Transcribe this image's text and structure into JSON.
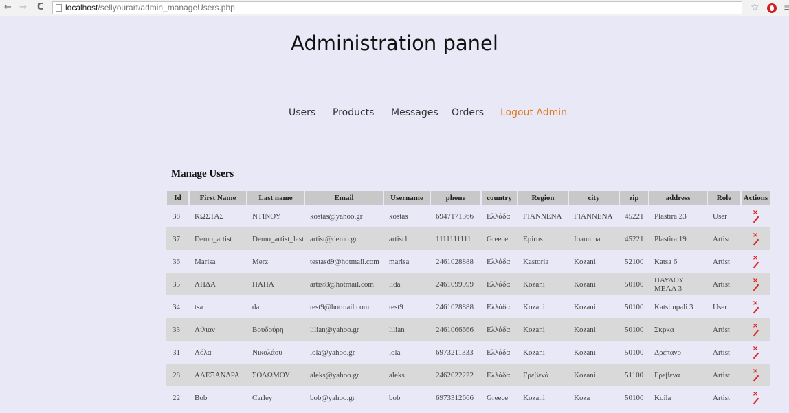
{
  "browser": {
    "back": "←",
    "forward": "→",
    "reload": "C",
    "url_host": "localhost",
    "url_path": "/sellyourart/admin_manageUsers.php"
  },
  "page": {
    "title": "Administration panel",
    "nav": [
      "Users",
      "Products",
      "Messages",
      "Orders",
      "Logout Admin"
    ]
  },
  "manage": {
    "title": "Manage Users",
    "columns": [
      "Id",
      "First Name",
      "Last name",
      "Email",
      "Username",
      "phone",
      "country",
      "Region",
      "city",
      "zip",
      "address",
      "Role",
      "Actions"
    ],
    "rows": [
      [
        "38",
        "ΚΩΣΤΑΣ",
        "ΝΤΙΝΟΥ",
        "kostas@yahoo.gr",
        "kostas",
        "6947171366",
        "Ελλάδα",
        "ΓΙΑΝΝΕΝΑ",
        "ΓΙΑΝΝΕΝΑ",
        "45221",
        "Plastira 23",
        "User"
      ],
      [
        "37",
        "Demo_artist",
        "Demo_artist_last",
        "artist@demo.gr",
        "artist1",
        "1111111111",
        "Greece",
        "Epirus",
        "Ioannina",
        "45221",
        "Plastira 19",
        "Artist"
      ],
      [
        "36",
        "Marisa",
        "Merz",
        "testasd9@hotmail.com",
        "marisa",
        "2461028888",
        "Ελλάδα",
        "Kastoria",
        "Kozani",
        "52100",
        "Katsa 6",
        "Artist"
      ],
      [
        "35",
        "ΛΗΔΑ",
        "ΠΑΠΑ",
        "artist8@hotmail.com",
        "lida",
        "2461099999",
        "Ελλάδα",
        "Kozani",
        "Kozani",
        "50100",
        "ΠΑΥΛΟΥ ΜΕΛΑ 3",
        "Artist"
      ],
      [
        "34",
        "tsa",
        "da",
        "test9@hotmail.com",
        "test9",
        "2461028888",
        "Ελλάδα",
        "Kozani",
        "Kozani",
        "50100",
        "Katsimpali 3",
        "User"
      ],
      [
        "33",
        "Λίλιαν",
        "Βουδούρη",
        "lilian@yahoo.gr",
        "lilian",
        "2461066666",
        "Ελλάδα",
        "Kozani",
        "Kozani",
        "50100",
        "Σκρκα",
        "Artist"
      ],
      [
        "31",
        "Λόλα",
        "Νικολάου",
        "lola@yahoo.gr",
        "lola",
        "6973211333",
        "Ελλάδα",
        "Kozani",
        "Kozani",
        "50100",
        "Δρέπανο",
        "Artist"
      ],
      [
        "28",
        "ΑΛΕΞΑΝΔΡΑ",
        "ΣΟΛΩΜΟΥ",
        "aleks@yahoo.gr",
        "aleks",
        "2462022222",
        "Ελλάδα",
        "Γρεβενά",
        "Kozani",
        "51100",
        "Γρεβενά",
        "Artist"
      ],
      [
        "22",
        "Bob",
        "Carley",
        "bob@yahoo.gr",
        "bob",
        "6973312666",
        "Greece",
        "Kozani",
        "Koza",
        "50100",
        "Koila",
        "Artist"
      ]
    ]
  },
  "icons": {
    "delete": "×",
    "edit": "pencil-icon"
  },
  "colors": {
    "accent_logout": "#e07820",
    "action_icon": "#e02020",
    "header_bg": "#c8c8c8",
    "page_bg": "#e8e8f7",
    "row_alt": "#d9d9d9"
  }
}
